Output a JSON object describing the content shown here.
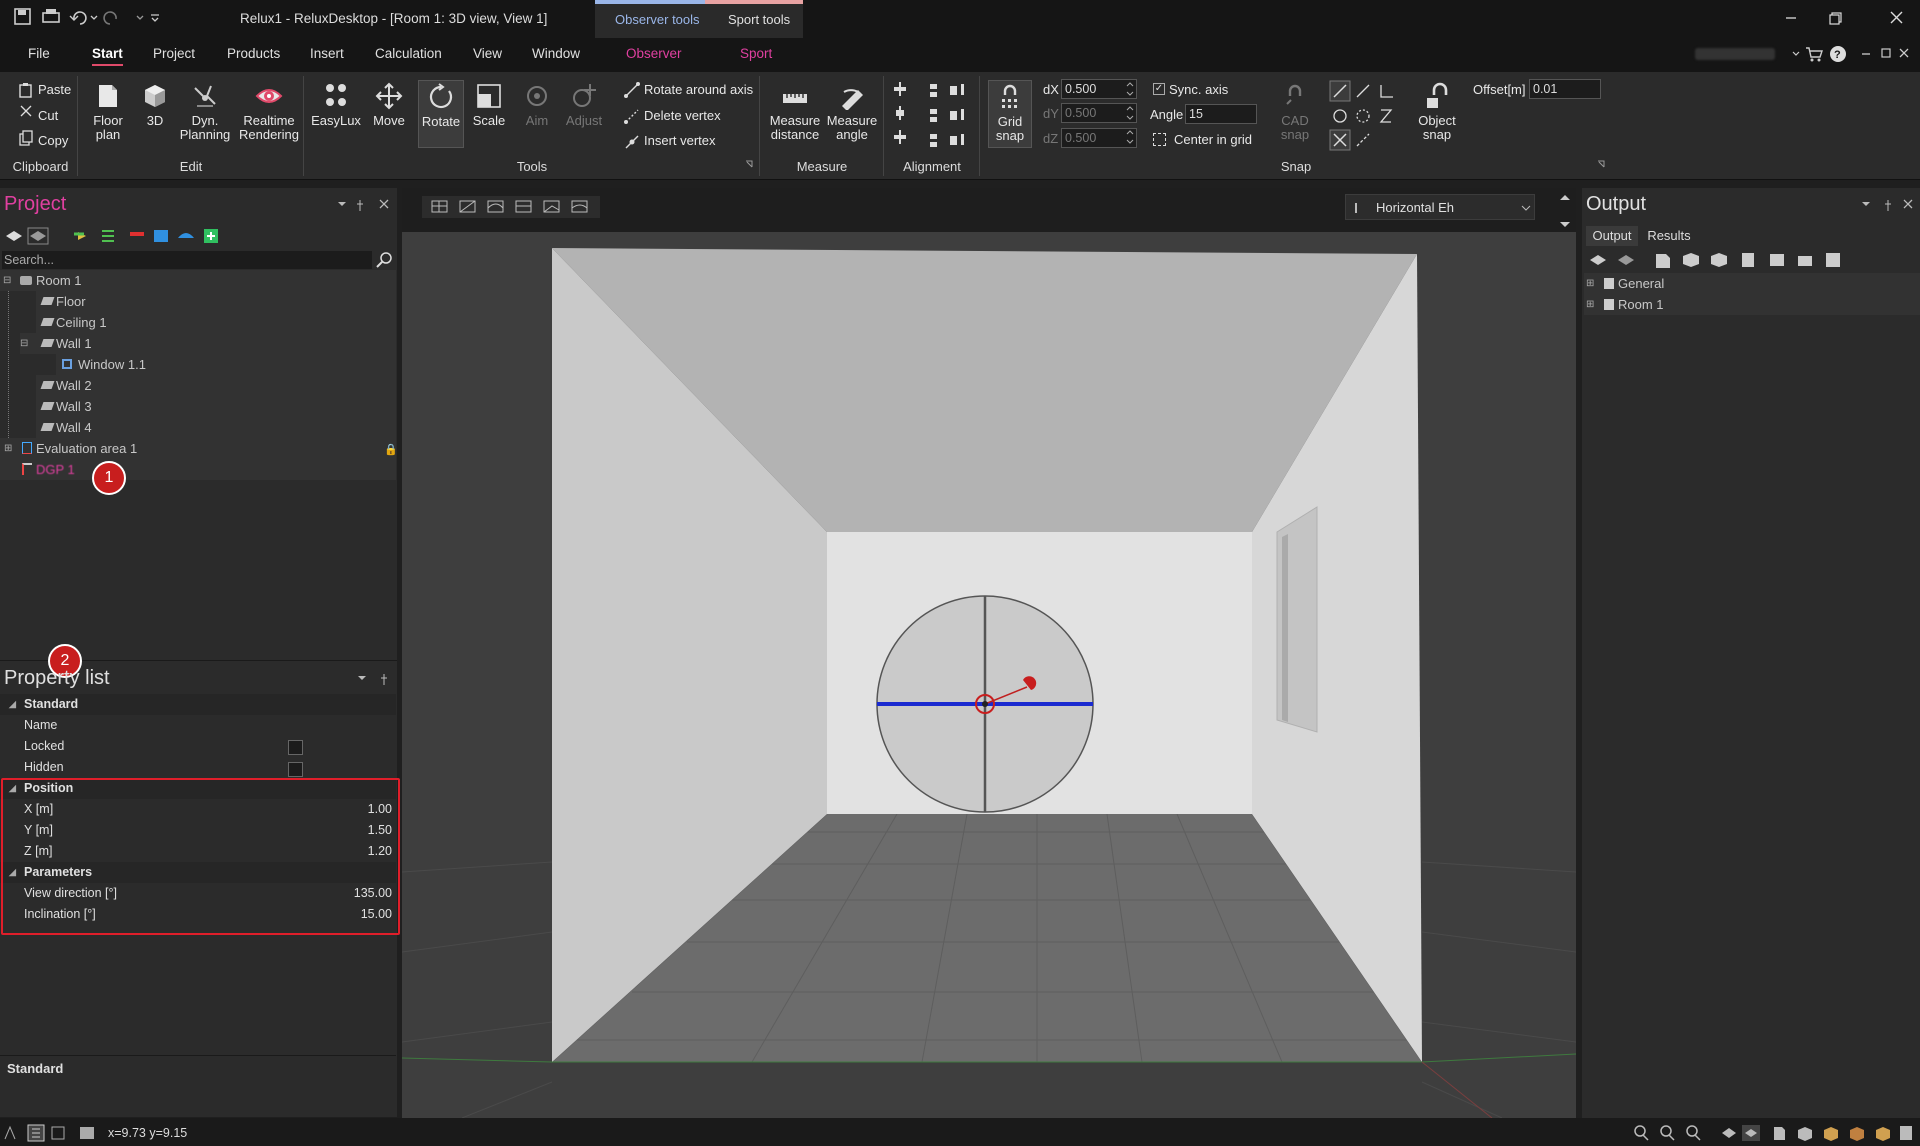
{
  "window": {
    "title": "Relux1 - ReluxDesktop - [Room 1: 3D view, View 1]",
    "context_tabs": [
      "Observer tools",
      "Sport tools"
    ]
  },
  "menu": [
    "File",
    "Start",
    "Project",
    "Products",
    "Insert",
    "Calculation",
    "View",
    "Window",
    "Observer",
    "Sport"
  ],
  "ribbon": {
    "clipboard": {
      "label": "Clipboard",
      "paste": "Paste",
      "cut": "Cut",
      "copy": "Copy"
    },
    "edit": {
      "label": "Edit",
      "floor_plan": [
        "Floor",
        "plan"
      ],
      "three_d": "3D",
      "dyn": [
        "Dyn.",
        "Planning"
      ],
      "realtime": [
        "Realtime",
        "Rendering"
      ]
    },
    "tools": {
      "label": "Tools",
      "easylux": "EasyLux",
      "move": "Move",
      "rotate": "Rotate",
      "scale": "Scale",
      "aim": "Aim",
      "adjust": "Adjust",
      "rotate_axis": "Rotate around axis",
      "delete_vertex": "Delete vertex",
      "insert_vertex": "Insert vertex"
    },
    "measure": {
      "label": "Measure",
      "distance": [
        "Measure",
        "distance"
      ],
      "angle": [
        "Measure",
        "angle"
      ]
    },
    "alignment": {
      "label": "Alignment"
    },
    "snap": {
      "label": "Snap",
      "grid_snap": [
        "Grid",
        "snap"
      ],
      "dx_label": "dX",
      "dx": "0.500",
      "dy_label": "dY",
      "dy": "0.500",
      "dz_label": "dZ",
      "dz": "0.500",
      "sync": "Sync. axis",
      "angle_label": "Angle",
      "angle": "15",
      "center": "Center in grid",
      "cad": [
        "CAD",
        "snap"
      ],
      "object": [
        "Object",
        "snap"
      ],
      "offset_label": "Offset[m]",
      "offset": "0.01"
    }
  },
  "project": {
    "title": "Project",
    "search_placeholder": "Search...",
    "tree": [
      "Room 1",
      "Floor",
      "Ceiling 1",
      "Wall 1",
      "Window 1.1",
      "Wall 2",
      "Wall 3",
      "Wall 4",
      "Evaluation area 1",
      "DGP 1"
    ]
  },
  "badges": [
    "1",
    "2"
  ],
  "properties": {
    "title": "Property list",
    "standard": "Standard",
    "name": "Name",
    "locked": "Locked",
    "hidden": "Hidden",
    "position": "Position",
    "x_label": "X [m]",
    "x": "1.00",
    "y_label": "Y [m]",
    "y": "1.50",
    "z_label": "Z [m]",
    "z": "1.20",
    "parameters": "Parameters",
    "view_dir_label": "View direction [°]",
    "view_dir": "135.00",
    "incl_label": "Inclination [°]",
    "incl": "15.00",
    "footer": "Standard"
  },
  "viewport": {
    "view_select": "Horizontal Eh"
  },
  "output": {
    "title": "Output",
    "tabs": [
      "Output",
      "Results"
    ],
    "tree": [
      "General",
      "Room 1"
    ]
  },
  "status": {
    "coords": "x=9.73 y=9.15"
  }
}
